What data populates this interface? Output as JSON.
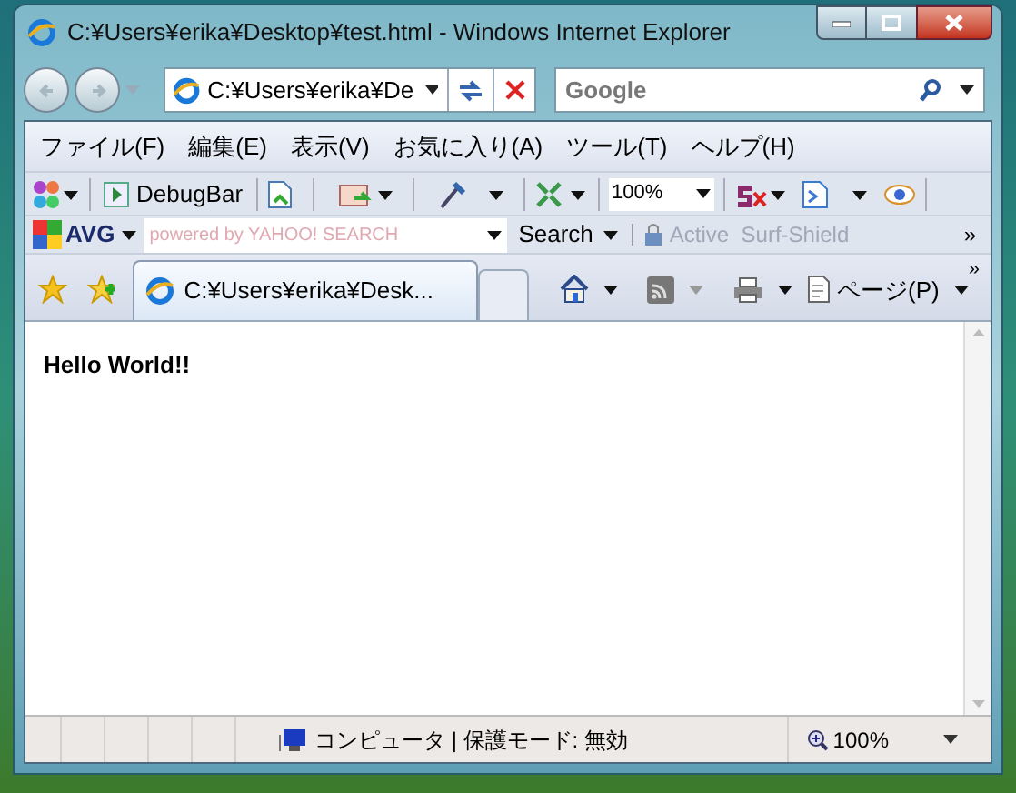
{
  "window": {
    "title": "C:¥Users¥erika¥Desktop¥test.html - Windows Internet Explorer"
  },
  "address_bar": {
    "value": "C:¥Users¥erika¥De"
  },
  "search": {
    "placeholder": "Google"
  },
  "menu": [
    "ファイル(F)",
    "編集(E)",
    "表示(V)",
    "お気に入り(A)",
    "ツール(T)",
    "ヘルプ(H)"
  ],
  "debug_toolbar": {
    "debugbar_label": "DebugBar",
    "zoom_value": "100%"
  },
  "avg_toolbar": {
    "logo": "AVG",
    "search_placeholder": "powered by YAHOO! SEARCH",
    "search_button": "Search",
    "surf_shield": {
      "label": "Active  Surf-Shield",
      "disabled": true
    },
    "overflow": "»"
  },
  "tabs": [
    {
      "label": "C:¥Users¥erika¥Desk...",
      "selected": true
    }
  ],
  "command_bar": {
    "page_menu": "ページ(P)",
    "overflow": "»"
  },
  "content": {
    "text": "Hello World!!"
  },
  "status_bar": {
    "zone": "コンピュータ | 保護モード: 無効",
    "zoom": "100%"
  }
}
